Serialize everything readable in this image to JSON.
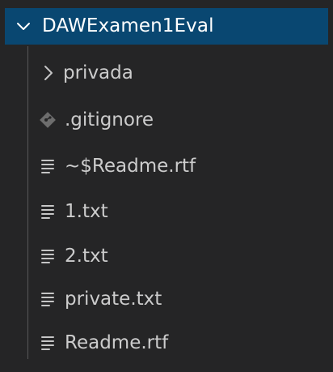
{
  "explorer": {
    "root": {
      "label": "DAWExamen1Eval",
      "icon": "chevron-down-icon",
      "expanded": true
    },
    "items": [
      {
        "label": "privada",
        "type": "folder",
        "icon": "chevron-right-icon"
      },
      {
        "label": ".gitignore",
        "type": "file",
        "icon": "git-diamond-icon"
      },
      {
        "label": "~$Readme.rtf",
        "type": "file",
        "icon": "text-lines-icon"
      },
      {
        "label": "1.txt",
        "type": "file",
        "icon": "text-lines-icon"
      },
      {
        "label": "2.txt",
        "type": "file",
        "icon": "text-lines-icon"
      },
      {
        "label": "private.txt",
        "type": "file",
        "icon": "text-lines-icon"
      },
      {
        "label": "Readme.rtf",
        "type": "file",
        "icon": "text-lines-icon"
      }
    ]
  },
  "colors": {
    "background": "#252526",
    "selection": "#094771",
    "text": "#cccccc",
    "root_text": "#ffffff",
    "icon": "#c5c5c5",
    "git_icon": "#6d6d6d",
    "indent_guide": "#585858"
  }
}
